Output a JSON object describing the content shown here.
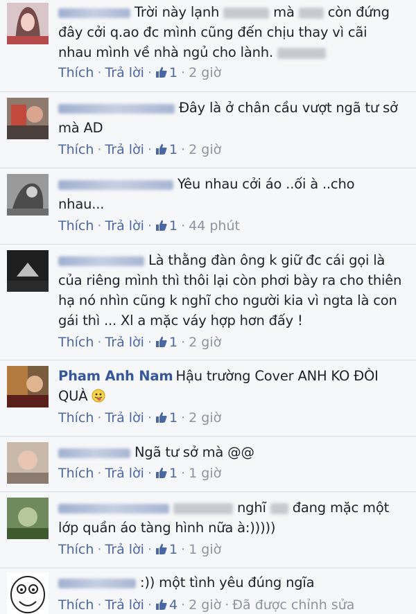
{
  "comments": [
    {
      "text": "Trời này lạnh",
      "text2": "mà",
      "text3": "còn đứng đây cởi q.ao đc mình cũng đến chịu thay vì cãi nhau mình về nhà ngủ cho lành.",
      "like_label": "Thích",
      "reply_label": "Trả lời",
      "likes": "1",
      "time": "2 giờ"
    },
    {
      "text": "Đây là ở chân cầu vượt ngã tư sở mà AD",
      "like_label": "Thích",
      "reply_label": "Trả lời",
      "likes": "1",
      "time": "2 giờ"
    },
    {
      "text": "Yêu nhau cởi áo ..ối à ..cho nhau...",
      "like_label": "Thích",
      "reply_label": "Trả lời",
      "likes": "1",
      "time": "44 phút"
    },
    {
      "text": "Là thằng đàn ông k giữ đc cái gọi là của riêng mình thì thôi lại còn phơi bày ra cho thiên hạ nó nhìn cũng k nghĩ cho người kia vì ngta là con gái thì ... Xl a mặc váy hợp hơn đấy !",
      "like_label": "Thích",
      "reply_label": "Trả lời",
      "likes": "1",
      "time": "2 giờ"
    },
    {
      "name": "Pham Anh Nam",
      "text": "Hậu trường Cover ANH KO ĐÒI QUÀ",
      "like_label": "Thích",
      "reply_label": "Trả lời",
      "likes": "1",
      "time": "2 giờ"
    },
    {
      "text": "Ngã tư sở mà @@",
      "like_label": "Thích",
      "reply_label": "Trả lời",
      "likes": "1",
      "time": "1 giờ"
    },
    {
      "text_a": "nghĩ",
      "text_b": "đang mặc một lớp quần áo tàng hình nữa à:)))))",
      "like_label": "Thích",
      "reply_label": "Trả lời",
      "likes": "1",
      "time": "1 giờ"
    },
    {
      "text": ":)) một tình yêu đúng ngĩa",
      "like_label": "Thích",
      "reply_label": "Trả lời",
      "likes": "4",
      "time": "2 giờ",
      "edited": "Đã được chỉnh sửa"
    }
  ],
  "colors": {
    "link": "#4b67a1",
    "name": "#365899",
    "meta": "#8d949e",
    "background": "#f6f7f9"
  }
}
